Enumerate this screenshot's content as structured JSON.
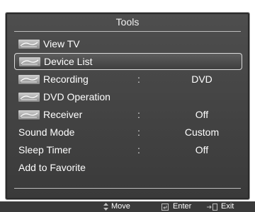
{
  "menu": {
    "title": "Tools",
    "items": [
      {
        "label": "View TV",
        "icon": "anynet-logo-icon",
        "value": ""
      },
      {
        "label": "Device List",
        "icon": "anynet-logo-icon",
        "value": "",
        "selected": true
      },
      {
        "label": "Recording",
        "icon": "anynet-logo-icon",
        "value": "DVD"
      },
      {
        "label": "DVD Operation",
        "icon": "anynet-logo-icon",
        "value": ""
      },
      {
        "label": "Receiver",
        "icon": "anynet-logo-icon",
        "value": "Off"
      },
      {
        "label": "Sound Mode",
        "icon": "",
        "value": "Custom"
      },
      {
        "label": "Sleep Timer",
        "icon": "",
        "value": "Off"
      },
      {
        "label": "Add to Favorite",
        "icon": "",
        "value": ""
      }
    ],
    "separator": ":"
  },
  "help": {
    "move": {
      "label": "Move",
      "icon": "updown-arrow-icon"
    },
    "enter": {
      "label": "Enter",
      "icon": "enter-icon"
    },
    "exit": {
      "label": "Exit",
      "icon": "exit-icon"
    }
  },
  "colors": {
    "panel": "#444444",
    "selection_border": "#dcdcdc",
    "text": "#ffffff"
  }
}
